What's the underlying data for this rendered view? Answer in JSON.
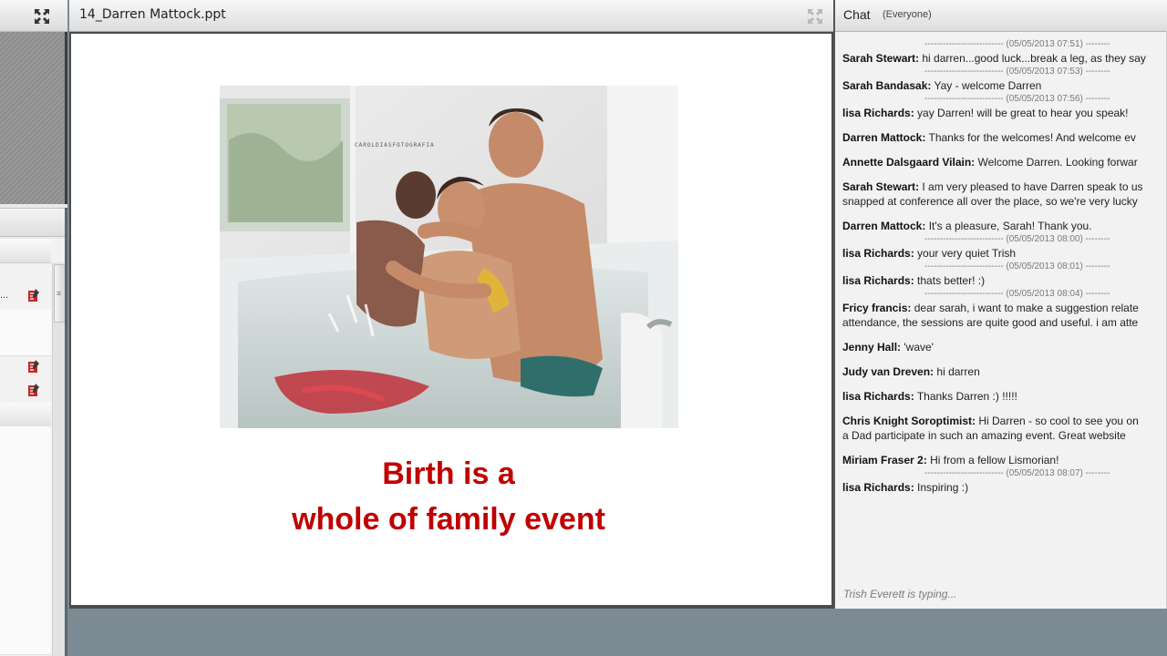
{
  "presentation": {
    "title": "14_Darren Mattock.ppt",
    "photo_watermark": "CAROLDIASFOTOGRAFIA",
    "caption_line1": "Birth is a",
    "caption_line2": "whole of family event",
    "caption_color": "#c00000"
  },
  "left_panel": {
    "truncated_text": "...",
    "grip": "≡"
  },
  "chat": {
    "title": "Chat",
    "scope": "(Everyone)",
    "typing_status": "Trish Everett is typing...",
    "messages": [
      {
        "time": "-------------------------- (05/05/2013 07:51) --------",
        "author": "Sarah Stewart:",
        "text": "hi darren...good luck...break a leg, as they say",
        "text2": ""
      },
      {
        "time": "-------------------------- (05/05/2013 07:53) --------",
        "author": "Sarah Bandasak:",
        "text": "Yay - welcome Darren",
        "text2": ""
      },
      {
        "time": "-------------------------- (05/05/2013 07:56) --------",
        "author": "lisa Richards:",
        "text": "yay Darren! will be great to hear you speak!",
        "text2": ""
      },
      {
        "time": "",
        "author": "Darren Mattock:",
        "text": "Thanks for the welcomes! And welcome ev",
        "text2": ""
      },
      {
        "time": "",
        "author": "Annette Dalsgaard Vilain:",
        "text": "Welcome Darren. Looking forwar",
        "text2": ""
      },
      {
        "time": "",
        "author": "Sarah Stewart:",
        "text": "I am very pleased to have Darren speak to us",
        "text2": "snapped at conference all over the place, so we're very lucky"
      },
      {
        "time": "",
        "author": "Darren Mattock:",
        "text": "It's a pleasure, Sarah! Thank you.",
        "text2": ""
      },
      {
        "time": "-------------------------- (05/05/2013 08:00) --------",
        "author": "lisa Richards:",
        "text": "your very quiet Trish",
        "text2": ""
      },
      {
        "time": "-------------------------- (05/05/2013 08:01) --------",
        "author": "lisa Richards:",
        "text": "thats better! :)",
        "text2": ""
      },
      {
        "time": "-------------------------- (05/05/2013 08:04) --------",
        "author": "Fricy francis:",
        "text": "dear sarah, i want to make a suggestion relate",
        "text2": "attendance, the sessions are quite good and useful. i am atte"
      },
      {
        "time": "",
        "author": "Jenny Hall:",
        "text": "'wave'",
        "text2": ""
      },
      {
        "time": "",
        "author": "Judy van Dreven:",
        "text": "hi darren",
        "text2": ""
      },
      {
        "time": "",
        "author": "lisa Richards:",
        "text": "Thanks Darren :) !!!!!",
        "text2": ""
      },
      {
        "time": "",
        "author": "Chris Knight Soroptimist:",
        "text": "Hi Darren - so cool to see you on",
        "text2": "a Dad participate in such an amazing event. Great website"
      },
      {
        "time": "",
        "author": "Miriam Fraser 2:",
        "text": "Hi from a fellow Lismorian!",
        "text2": ""
      },
      {
        "time": "-------------------------- (05/05/2013 08:07) --------",
        "author": "lisa Richards:",
        "text": "Inspiring :)",
        "text2": ""
      }
    ]
  }
}
